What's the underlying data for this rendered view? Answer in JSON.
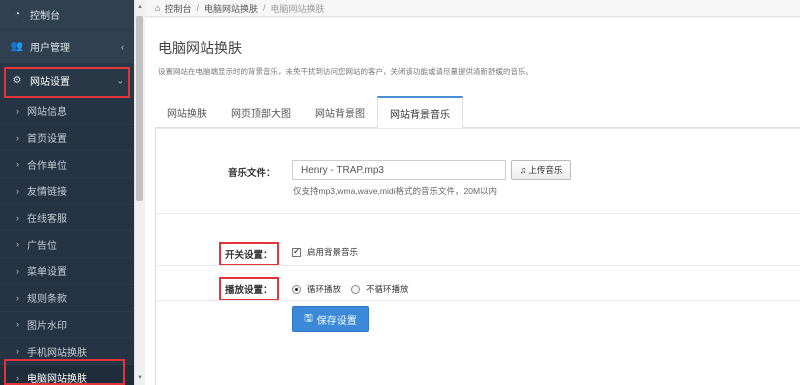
{
  "sidebar": {
    "top_items": [
      {
        "label": "控制台",
        "icon": "dashboard-icon"
      },
      {
        "label": "用户管理",
        "icon": "users-icon",
        "arrow": "‹"
      },
      {
        "label": "网站设置",
        "icon": "settings-icon",
        "arrow": "⌄"
      }
    ],
    "sub_items": [
      {
        "label": "网站信息"
      },
      {
        "label": "首页设置"
      },
      {
        "label": "合作单位"
      },
      {
        "label": "友情链接"
      },
      {
        "label": "在线客服"
      },
      {
        "label": "广告位"
      },
      {
        "label": "菜单设置"
      },
      {
        "label": "规则条款"
      },
      {
        "label": "图片水印"
      },
      {
        "label": "手机网站换肤"
      },
      {
        "label": "电脑网站换肤"
      }
    ]
  },
  "breadcrumb": {
    "home": "控制台",
    "level1": "电脑网站换肤",
    "current": "电脑网站换肤"
  },
  "main": {
    "title": "电脑网站换肤",
    "description": "设置网站在电脑端显示时的背景音乐，未免干扰到访问您网站的客户，关闭该功能或请尽量提供清新舒缓的音乐。",
    "tabs": [
      {
        "label": "网站换肤",
        "active": false
      },
      {
        "label": "网页顶部大图",
        "active": false
      },
      {
        "label": "网站背景图",
        "active": false
      },
      {
        "label": "网站背景音乐",
        "active": true
      }
    ],
    "form": {
      "music_label": "音乐文件：",
      "music_value": "Henry - TRAP.mp3",
      "upload_label": "上传音乐",
      "music_help": "仅支持mp3,wma,wave,midi格式的音乐文件，20M以内",
      "switch_label": "开关设置：",
      "enable_bgm_label": "启用背景音乐",
      "enable_bgm_checked": true,
      "play_label": "播放设置：",
      "play_options": [
        {
          "label": "循环播放",
          "selected": true
        },
        {
          "label": "不循环播放",
          "selected": false
        }
      ],
      "save_label": "保存设置"
    }
  },
  "colors": {
    "sidebar_bg": "#2f4050",
    "highlight": "#e3343b",
    "primary": "#3b8ad9",
    "tab_accent": "#4a8fd6"
  }
}
